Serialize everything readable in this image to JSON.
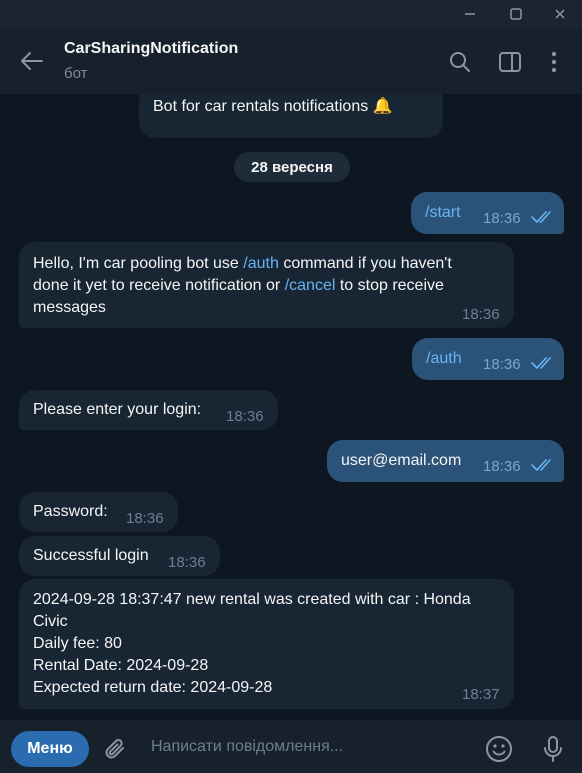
{
  "window": {
    "minimize_icon": "minimize-icon",
    "maximize_icon": "maximize-icon",
    "close_icon": "close-icon"
  },
  "header": {
    "title": "CarSharingNotification",
    "subtitle": "бот",
    "icons": [
      "back-arrow-icon",
      "search-icon",
      "sidebar-toggle-icon",
      "more-vert-icon"
    ]
  },
  "messages": {
    "bot_description": "Bot for car rentals notifications 🔔",
    "date_pill": "28 вересня",
    "m1": {
      "text": "/start",
      "time": "18:36"
    },
    "m2": {
      "line1_a": "Hello, I'm car pooling bot use ",
      "line1_cmd": "/auth",
      "line1_b": " command if you haven't",
      "line2_a": "done it yet to receive notification or ",
      "line2_cmd": "/cancel",
      "line2_b": " to stop receive",
      "line3": "messages",
      "time": "18:36"
    },
    "m3": {
      "text": "/auth",
      "time": "18:36"
    },
    "m4": {
      "text": "Please enter your login:",
      "time": "18:36"
    },
    "m5": {
      "text": "user@email.com",
      "time": "18:36"
    },
    "m6": {
      "text": "Password:",
      "time": "18:36"
    },
    "m7": {
      "text": "Successful login",
      "time": "18:36"
    },
    "m8": {
      "line1": "2024-09-28 18:37:47 new rental was created with car : Honda",
      "line2": "Civic",
      "line3": "Daily fee: 80",
      "line4": "Rental Date: 2024-09-28",
      "line5": "Expected return date: 2024-09-28",
      "time": "18:37"
    }
  },
  "composer": {
    "menu_label": "Меню",
    "placeholder": "Написати повідомлення...",
    "icons": [
      "attach-icon",
      "emoji-icon",
      "microphone-icon"
    ]
  },
  "colors": {
    "background": "#0e1621",
    "incoming_bubble": "#182533",
    "outgoing_bubble": "#2b5278",
    "link": "#6ab3f3",
    "menu_button": "#2b6cb0"
  }
}
